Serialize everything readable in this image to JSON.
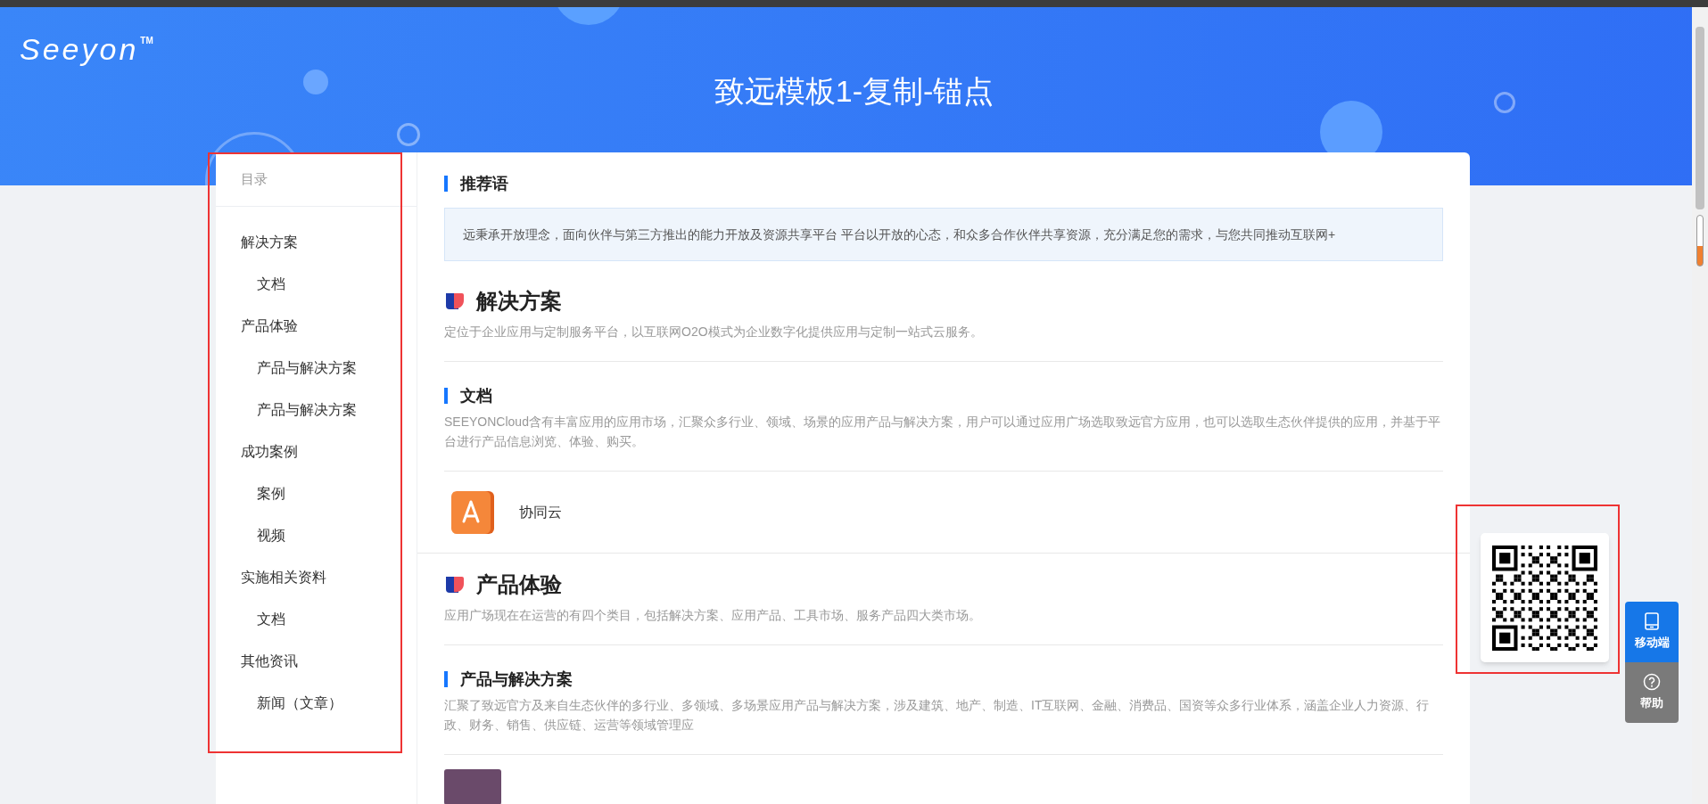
{
  "header": {
    "logo": "Seeyon",
    "trademark": "TM",
    "title": "致远模板1-复制-锚点"
  },
  "toc": {
    "title": "目录",
    "items": [
      {
        "label": "解决方案",
        "children": [
          {
            "label": "文档"
          }
        ]
      },
      {
        "label": "产品体验",
        "children": [
          {
            "label": "产品与解决方案"
          },
          {
            "label": "产品与解决方案"
          }
        ]
      },
      {
        "label": "成功案例",
        "children": [
          {
            "label": "案例"
          },
          {
            "label": "视频"
          }
        ]
      },
      {
        "label": "实施相关资料",
        "children": [
          {
            "label": "文档"
          }
        ]
      },
      {
        "label": "其他资讯",
        "children": [
          {
            "label": "新闻（文章）"
          }
        ]
      }
    ]
  },
  "sections": [
    {
      "kind": "intro",
      "heading": "推荐语",
      "text": "远秉承开放理念，面向伙伴与第三方推出的能力开放及资源共享平台 平台以开放的心态，和众多合作伙伴共享资源，充分满足您的需求，与您共同推动互联网+"
    },
    {
      "kind": "group",
      "heading": "解决方案",
      "description": "定位于企业应用与定制服务平台，以互联网O2O模式为企业数字化提供应用与定制一站式云服务。"
    },
    {
      "kind": "sub",
      "heading": "文档",
      "description": "SEEYONCloud含有丰富应用的应用市场，汇聚众多行业、领域、场景的应用产品与解决方案，用户可以通过应用广场选取致远官方应用，也可以选取生态伙伴提供的应用，并基于平台进行产品信息浏览、体验、购买。"
    },
    {
      "kind": "file",
      "name": "协同云"
    },
    {
      "kind": "group",
      "heading": "产品体验",
      "description": "应用广场现在在运营的有四个类目，包括解决方案、应用产品、工具市场、服务产品四大类市场。"
    },
    {
      "kind": "sub",
      "heading": "产品与解决方案",
      "description": "汇聚了致远官方及来自生态伙伴的多行业、多领域、多场景应用产品与解决方案，涉及建筑、地产、制造、IT互联网、金融、消费品、国资等众多行业体系，涵盖企业人力资源、行政、财务、销售、供应链、运营等领域管理应"
    },
    {
      "kind": "media"
    }
  ],
  "side_buttons": [
    {
      "kind": "mobile",
      "label": "移动端",
      "selected": true
    },
    {
      "kind": "help",
      "label": "帮助",
      "selected": false
    }
  ]
}
